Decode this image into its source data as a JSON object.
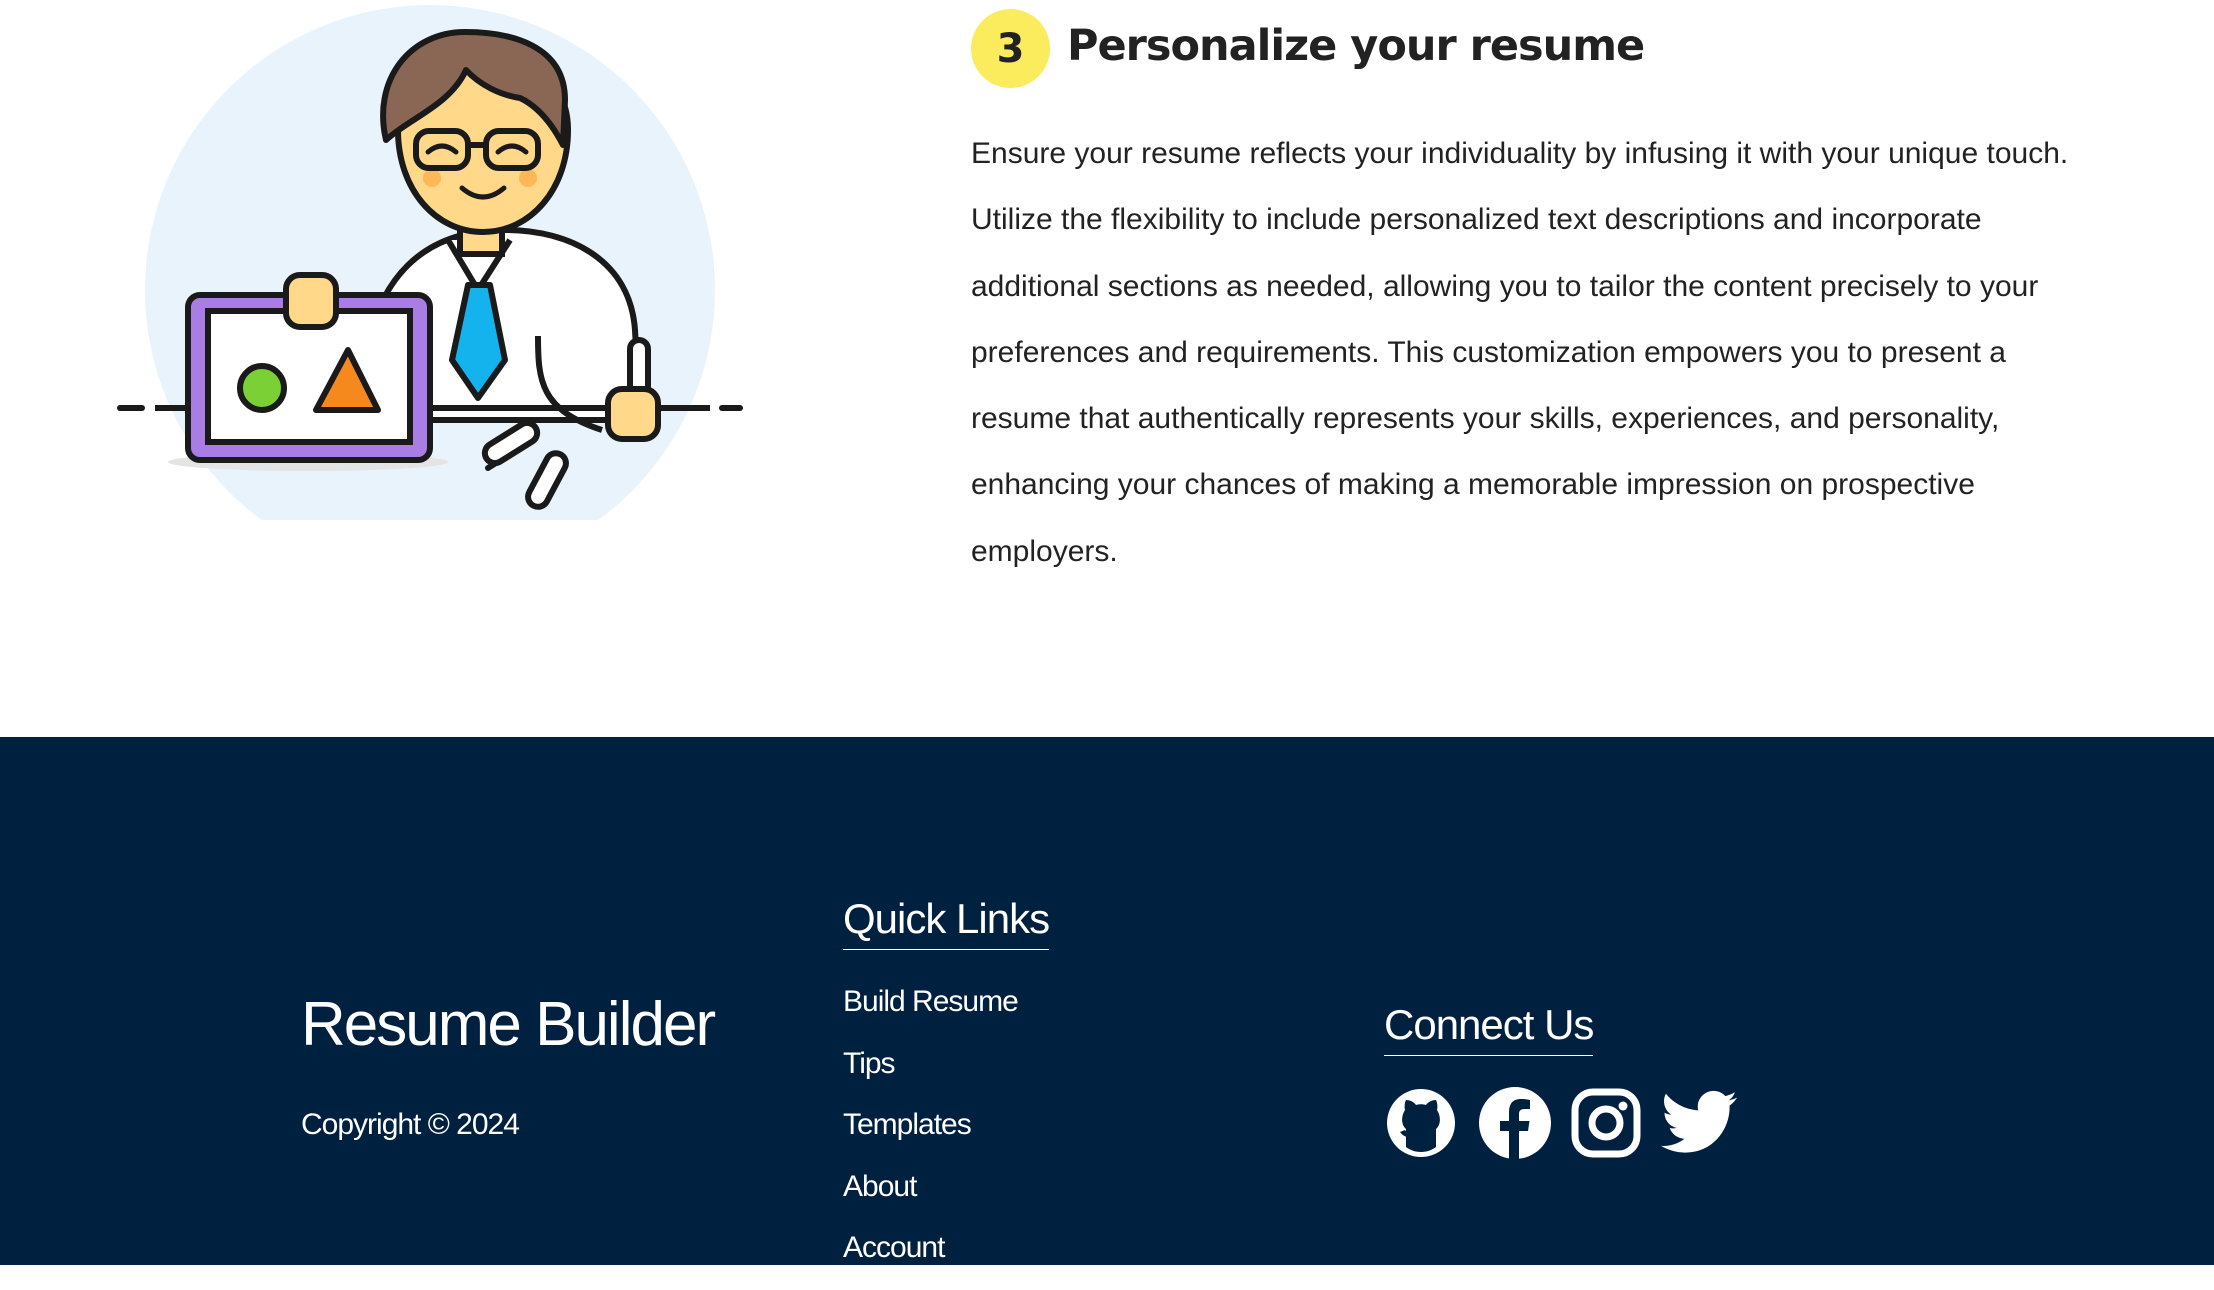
{
  "step": {
    "number": "3",
    "title": "Personalize your resume",
    "description": "Ensure your resume reflects your individuality by infusing it with your unique touch. Utilize the flexibility to include personalized text descriptions and incorporate additional sections as needed, allowing you to tailor the content precisely to your preferences and requirements. This customization empowers you to present a resume that authentically represents your skills, experiences, and personality, enhancing your chances of making a memorable impression on prospective employers."
  },
  "footer": {
    "brand_name": "Resume Builder",
    "copyright": "Copyright © 2024",
    "quick_links": {
      "title": "Quick Links",
      "items": [
        {
          "label": "Build Resume"
        },
        {
          "label": "Tips"
        },
        {
          "label": "Templates"
        },
        {
          "label": "About"
        },
        {
          "label": "Account"
        }
      ]
    },
    "connect": {
      "title": "Connect Us",
      "icons": [
        "github-icon",
        "facebook-icon",
        "instagram-icon",
        "twitter-icon"
      ]
    }
  },
  "colors": {
    "footer_bg": "#002040",
    "badge_bg": "#fbec5d",
    "text_dark": "#222222",
    "illustration_bg_circle": "#e9f3fb",
    "board_frame": "#a97ce6",
    "tie": "#14b3ee",
    "circle_shape": "#7ad034",
    "triangle_shape": "#f5891e",
    "hair": "#8a6654",
    "skin": "#ffd88a"
  }
}
